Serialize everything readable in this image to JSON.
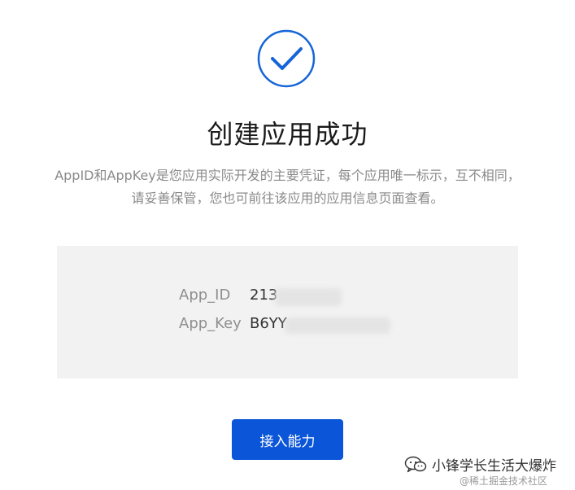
{
  "success": {
    "icon": "check-circle-icon",
    "title": "创建应用成功",
    "description": "AppID和AppKey是您应用实际开发的主要凭证，每个应用唯一标示，互不相同，请妥善保管，您也可前往该应用的应用信息页面查看。"
  },
  "credentials": {
    "app_id": {
      "label": "App_ID",
      "value_visible": "213"
    },
    "app_key": {
      "label": "App_Key",
      "value_visible": "B6YY"
    }
  },
  "actions": {
    "access_capability_label": "接入能力"
  },
  "watermark": {
    "icon": "wechat-icon",
    "account": "小锋学长生活大爆炸",
    "site": "@稀土掘金技术社区"
  },
  "colors": {
    "accent": "#0a55d8",
    "check_stroke": "#1565d8",
    "panel_bg": "#f2f2f2",
    "title": "#1a1a1a",
    "desc": "#8a8a8a"
  }
}
